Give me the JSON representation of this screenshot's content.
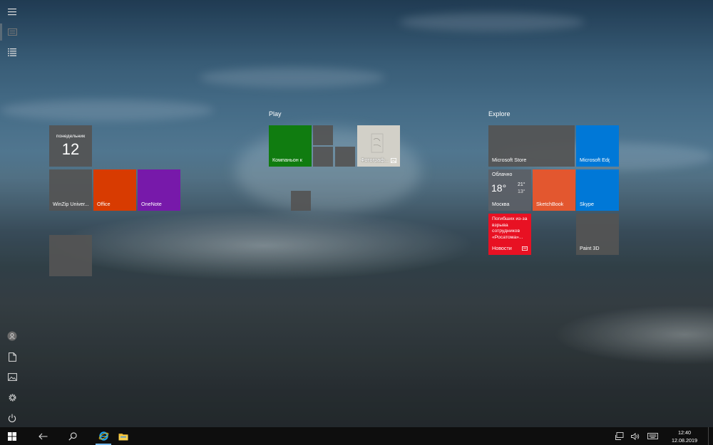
{
  "groups": [
    {
      "title": ""
    },
    {
      "title": "Play"
    },
    {
      "title": "Explore"
    }
  ],
  "tiles": {
    "calendar": {
      "day_name": "понедельник",
      "day_number": "12"
    },
    "winzip": {
      "label": "WinZip Univer..."
    },
    "office": {
      "label": "Office",
      "color": "#d83b01"
    },
    "onenote": {
      "label": "OneNote",
      "color": "#7719aa"
    },
    "companion": {
      "label": "Компаньон к...",
      "color": "#107c10"
    },
    "photos": {
      "label": "Фотограф..."
    },
    "store": {
      "label": "Microsoft Store"
    },
    "edge": {
      "label": "Microsoft Edge",
      "color": "#0078d7"
    },
    "weather": {
      "condition": "Облачно",
      "temp": "18°",
      "high": "21°",
      "low": "13°",
      "city": "Москва"
    },
    "sketchbook": {
      "label": "SketchBook",
      "color": "#e3572f"
    },
    "skype": {
      "label": "Skype",
      "color": "#0078d7"
    },
    "news": {
      "headline": "Погибших из-за взрыва сотрудников «Росатома»...",
      "label": "Новости",
      "color": "#e81123"
    },
    "paint3d": {
      "label": "Paint 3D"
    }
  },
  "rail": {
    "items": [
      "hamburger-menu-icon",
      "pinned-tiles-icon",
      "all-apps-list-icon",
      "user-icon",
      "documents-icon",
      "pictures-icon",
      "settings-icon",
      "power-icon"
    ]
  },
  "taskbar": {
    "time": "12:40",
    "date": "12.08.2019",
    "accent": "#76b9ed"
  }
}
